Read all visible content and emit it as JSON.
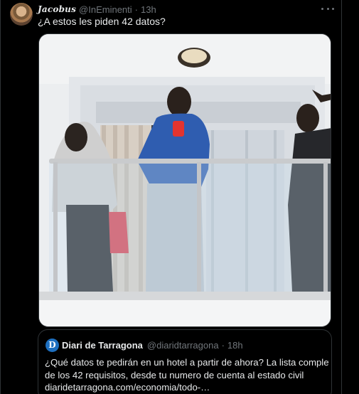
{
  "tweet": {
    "display_name": "Jacobus",
    "handle": "@InEminenti",
    "separator": "·",
    "time": "13h",
    "text": "¿A estos les piden 42 datos?",
    "more_icon": "more-horizontal-icon"
  },
  "quoted_tweet": {
    "logo_letter": "D",
    "name": "Diari de Tarragona",
    "handle": "@diaridtarragona",
    "separator": "·",
    "time": "18h",
    "lines": [
      "¿Qué datos te pedirán en un hotel a partir de ahora? La lista completa",
      "de los 42 requisitos, desde tu numero de cuenta al estado civil",
      "diaridetarragona.com/economia/todo-…"
    ]
  },
  "colors": {
    "background": "#000000",
    "text_primary": "#e7e9ea",
    "text_secondary": "#71767b",
    "border": "#2f3336",
    "logo_blue": "#1d6fc0"
  }
}
